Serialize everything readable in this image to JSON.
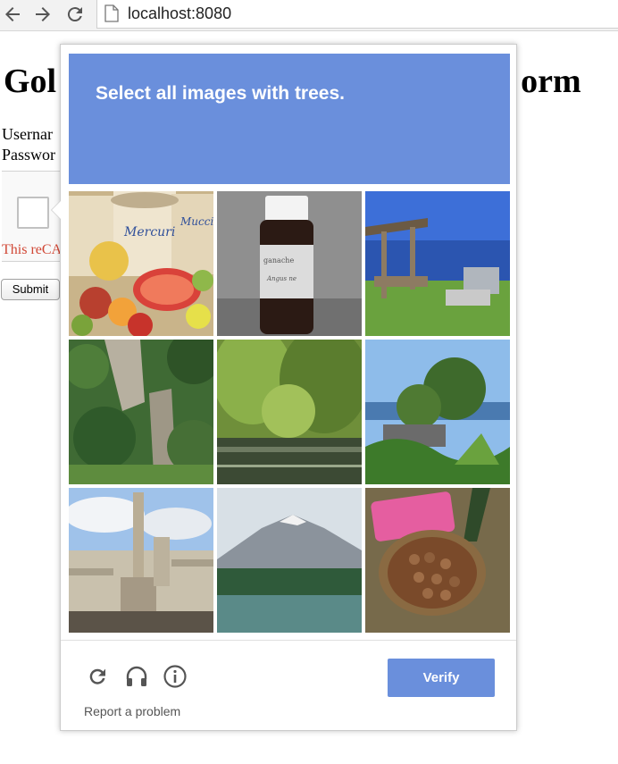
{
  "browser": {
    "url": "localhost:8080"
  },
  "page": {
    "title": "Gol",
    "title_tail": "orm",
    "username_label": "Usernar",
    "password_label": "Passwor",
    "recaptcha_error": "This reCA",
    "submit_label": "Submit"
  },
  "challenge": {
    "prompt_prefix": "Select all images with",
    "prompt_keyword": "trees.",
    "tiles": [
      {
        "label": "fruit-tins"
      },
      {
        "label": "bottle"
      },
      {
        "label": "lakeside-shelter"
      },
      {
        "label": "rocky-forest"
      },
      {
        "label": "willow-pond"
      },
      {
        "label": "tropical-trees"
      },
      {
        "label": "plague-column"
      },
      {
        "label": "mountain-lake"
      },
      {
        "label": "nut-basket"
      }
    ],
    "report_label": "Report a problem",
    "verify_label": "Verify",
    "accent_color": "#6a8fdc"
  }
}
